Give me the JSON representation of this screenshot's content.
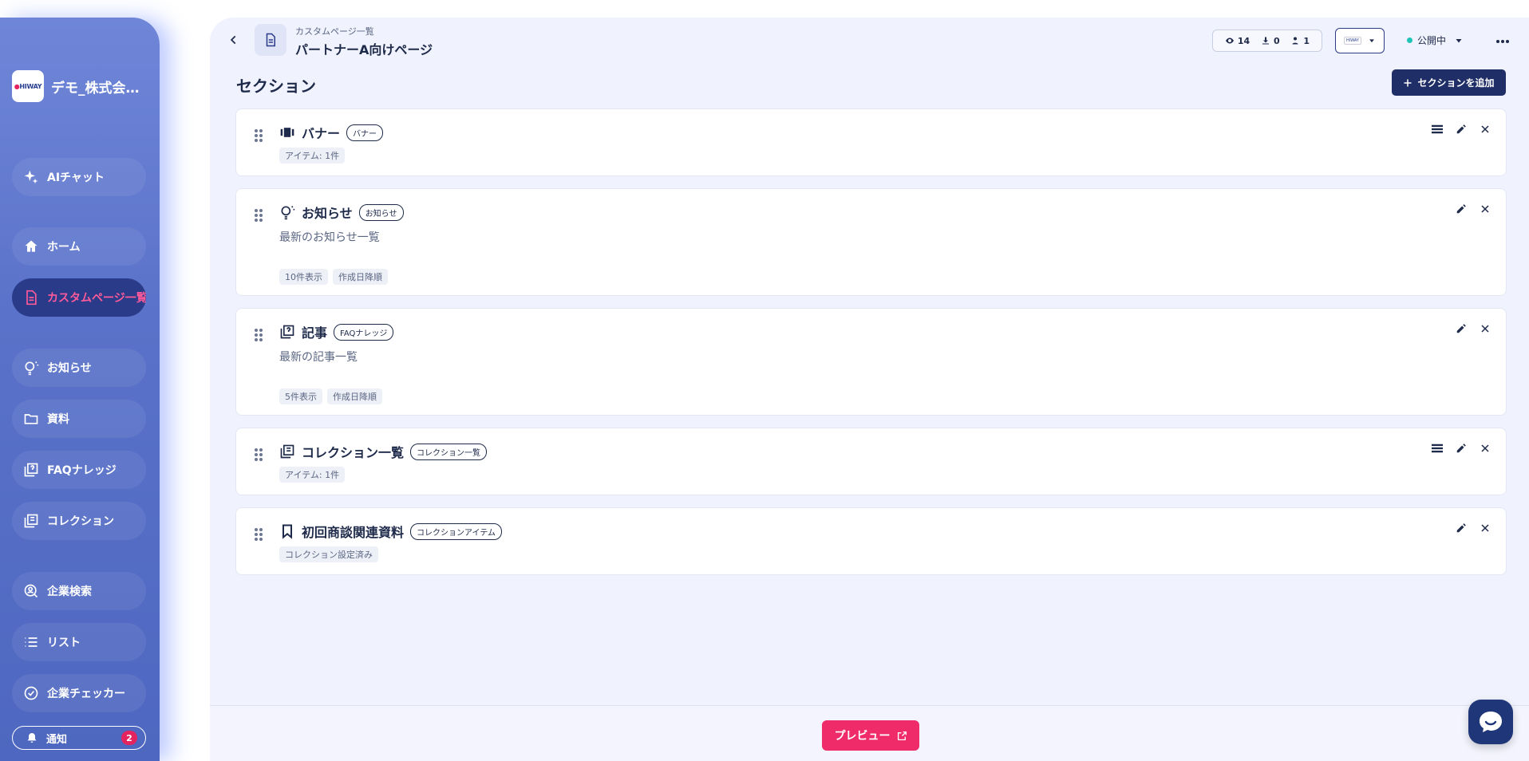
{
  "sidebar": {
    "brand_logo": "HIWAY",
    "brand_name": "デモ_株式会社HIWAY",
    "items": [
      {
        "label": "AIチャット",
        "icon": "sparkle-icon"
      },
      {
        "label": "ホーム",
        "icon": "home-icon"
      },
      {
        "label": "カスタムページ一覧",
        "icon": "document-icon",
        "active": true
      },
      {
        "label": "お知らせ",
        "icon": "lightbulb-icon"
      },
      {
        "label": "資料",
        "icon": "folder-icon"
      },
      {
        "label": "FAQナレッジ",
        "icon": "faq-icon"
      },
      {
        "label": "コレクション",
        "icon": "collection-icon"
      },
      {
        "label": "企業検索",
        "icon": "company-search-icon"
      },
      {
        "label": "リスト",
        "icon": "list-icon"
      },
      {
        "label": "企業チェッカー",
        "icon": "check-circle-icon"
      }
    ],
    "notification": {
      "label": "通知",
      "count": "2"
    }
  },
  "header": {
    "breadcrumb": "カスタムページ一覧",
    "title": "パートナーA向けページ",
    "stats": {
      "views": "14",
      "downloads": "0",
      "users": "1"
    },
    "status": "公開中"
  },
  "main": {
    "section_heading": "セクション",
    "add_button": "セクションを追加",
    "cards": [
      {
        "title": "バナー",
        "tag": "バナー",
        "desc": "",
        "chips": [
          "アイテム: 1件"
        ]
      },
      {
        "title": "お知らせ",
        "tag": "お知らせ",
        "desc": "最新のお知らせ一覧",
        "chips": [
          "10件表示",
          "作成日降順"
        ]
      },
      {
        "title": "記事",
        "tag": "FAQナレッジ",
        "desc": "最新の記事一覧",
        "chips": [
          "5件表示",
          "作成日降順"
        ]
      },
      {
        "title": "コレクション一覧",
        "tag": "コレクション一覧",
        "desc": "",
        "chips": [
          "アイテム: 1件"
        ]
      },
      {
        "title": "初回商談関連資料",
        "tag": "コレクションアイテム",
        "desc": "",
        "chips": [
          "コレクション設定済み"
        ]
      }
    ]
  },
  "footer": {
    "preview_button": "プレビュー"
  },
  "colors": {
    "accent": "#ef2b6a",
    "navy": "#1f2e66",
    "sidebar": "#5a72c9",
    "status": "#20c4b6"
  }
}
